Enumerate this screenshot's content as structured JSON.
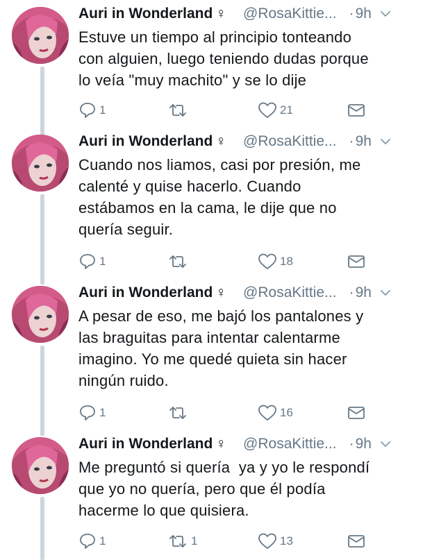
{
  "tweets": [
    {
      "name": "Auri in Wonderland",
      "gender_symbol": "♀",
      "handle": "@RosaKittie...",
      "dot": "·",
      "time": "9h",
      "text": "Estuve un tiempo al principio tonteando\ncon alguien, luego teniendo dudas porque\nlo veía \"muy machito\" y se lo dije",
      "replies": "1",
      "retweets": "",
      "likes": "21"
    },
    {
      "name": "Auri in Wonderland",
      "gender_symbol": "♀",
      "handle": "@RosaKittie...",
      "dot": "·",
      "time": "9h",
      "text": "Cuando nos liamos, casi por presión, me\ncalenté y quise hacerlo. Cuando\nestábamos en la cama, le dije que no\nquería seguir.",
      "replies": "1",
      "retweets": "",
      "likes": "18"
    },
    {
      "name": "Auri in Wonderland",
      "gender_symbol": "♀",
      "handle": "@RosaKittie...",
      "dot": "·",
      "time": "9h",
      "text": "A pesar de eso, me bajó los pantalones y\nlas braguitas para intentar calentarme\nimagino. Yo me quedé quieta sin hacer\nningún ruido.",
      "replies": "1",
      "retweets": "",
      "likes": "16"
    },
    {
      "name": "Auri in Wonderland",
      "gender_symbol": "♀",
      "handle": "@RosaKittie...",
      "dot": "·",
      "time": "9h",
      "text": "Me preguntó si quería  ya y yo le respondí\nque yo no quería, pero que él podía\nhacerme lo que quisiera.",
      "replies": "1",
      "retweets": "1",
      "likes": "13"
    }
  ],
  "icons": {
    "reply": "reply-icon",
    "retweet": "retweet-icon",
    "like": "heart-icon",
    "dm": "envelope-icon",
    "menu": "chevron-down-icon"
  },
  "colors": {
    "text": "#14171a",
    "secondary": "#657786",
    "thread_line": "#ccd6dd"
  }
}
